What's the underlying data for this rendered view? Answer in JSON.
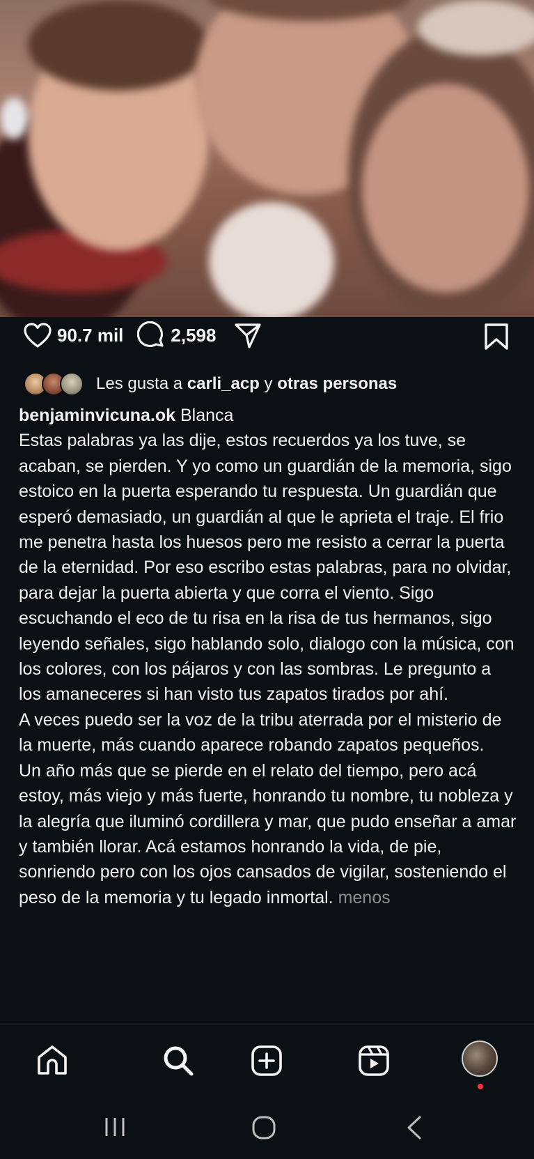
{
  "post": {
    "likes_count": "90.7 mil",
    "comments_count": "2,598",
    "liked_by_prefix": "Les gusta a ",
    "liked_by_user": "carli_acp",
    "liked_by_connector": " y ",
    "liked_by_suffix": "otras personas",
    "author": "benjaminvicuna.ok",
    "caption": " Blanca\nEstas palabras ya las dije, estos recuerdos ya los tuve, se acaban, se pierden. Y yo como un guardián de la memoria, sigo estoico en la puerta esperando tu respuesta. Un guardián que esperó demasiado, un guardián al que le aprieta el traje. El frio me penetra hasta los huesos pero me resisto a cerrar la puerta de la eternidad. Por eso escribo estas palabras, para no olvidar, para dejar la puerta abierta y que corra el viento. Sigo escuchando el eco de tu risa en la risa de tus hermanos, sigo leyendo señales, sigo hablando solo, dialogo con la música, con los colores, con los pájaros y con las sombras. Le pregunto a los amaneceres si han visto tus zapatos tirados por ahí.\nA veces puedo ser la voz de la tribu aterrada por el misterio de la muerte, más cuando aparece robando zapatos pequeños.\nUn año más  que se pierde en el relato del tiempo, pero acá estoy, más viejo y más fuerte, honrando tu nombre, tu nobleza y la alegría que iluminó cordillera y mar, que pudo enseñar a amar y también llorar. Acá estamos honrando la vida, de pie, sonriendo pero con los ojos cansados de vigilar,  sosteniendo el peso de la memoria y tu legado inmortal. ",
    "less_link": "menos"
  },
  "icons": {
    "like": "heart-icon",
    "comment": "comment-icon",
    "share": "send-icon",
    "save": "bookmark-icon"
  },
  "nav": [
    "home-icon",
    "search-icon",
    "create-icon",
    "reels-icon",
    "profile-avatar"
  ],
  "colors": {
    "background": "#0b1014",
    "text": "#f5f5f5",
    "muted": "#8e8e8e",
    "notification": "#ff3040"
  }
}
